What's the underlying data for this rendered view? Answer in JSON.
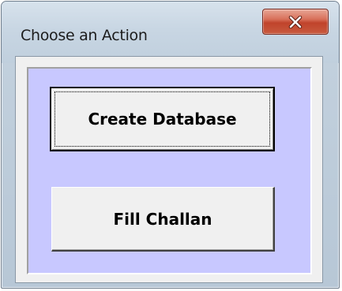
{
  "window": {
    "title": "Choose an Action"
  },
  "titlebar": {
    "close_icon": "close-x-icon",
    "accent_color": "#c0432b"
  },
  "form": {
    "panel_color": "#c8c8ff",
    "buttons": [
      {
        "label": "Create Database",
        "focused": true
      },
      {
        "label": "Fill Challan",
        "focused": false
      }
    ]
  }
}
